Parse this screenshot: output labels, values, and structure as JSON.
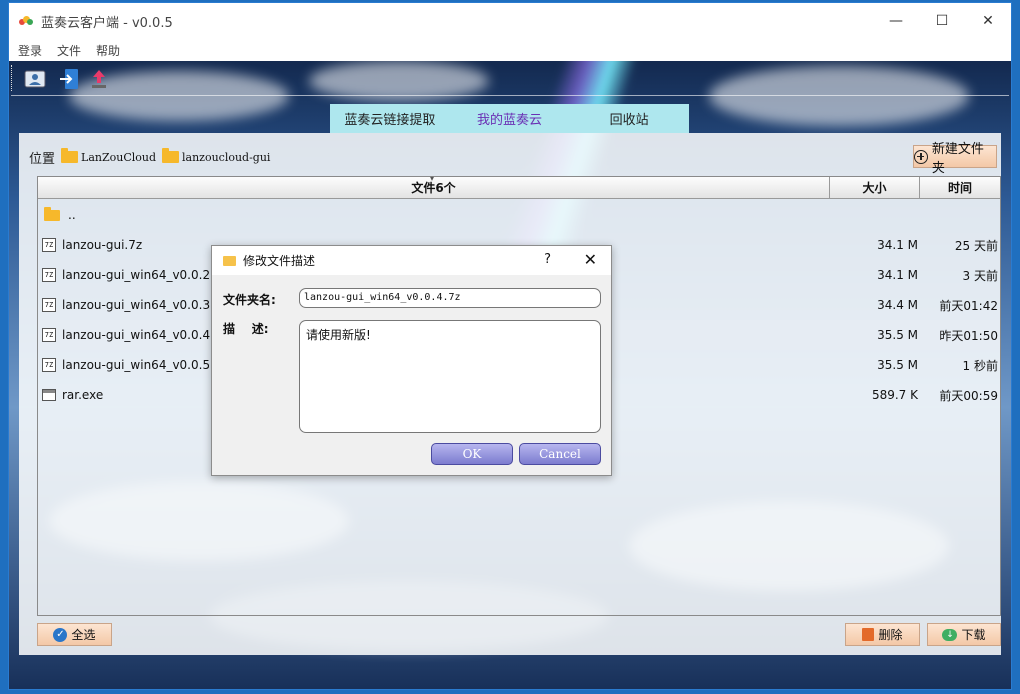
{
  "window": {
    "title": "蓝奏云客户端 - v0.0.5",
    "controls": {
      "minimize": "—",
      "maximize": "☐",
      "close": "✕"
    }
  },
  "menu": [
    "登录",
    "文件",
    "帮助"
  ],
  "toolbar": {
    "icons": [
      "user-card-icon",
      "login-arrow-icon",
      "upload-arrow-icon"
    ]
  },
  "tabs": [
    {
      "label": "蓝奏云链接提取",
      "active": false
    },
    {
      "label": "我的蓝奏云",
      "active": true
    },
    {
      "label": "回收站",
      "active": false
    }
  ],
  "location": {
    "label": "位置",
    "crumbs": [
      "LanZouCloud",
      "lanzoucloud-gui"
    ]
  },
  "new_folder_label": "新建文件夹",
  "table": {
    "columns": {
      "name": "文件6个",
      "size": "大小",
      "time": "时间"
    },
    "rows": [
      {
        "name": "..",
        "size": "",
        "time": "",
        "type": "folder"
      },
      {
        "name": "lanzou-gui.7z",
        "size": "34.1 M",
        "time": "25 天前",
        "type": "7z"
      },
      {
        "name": "lanzou-gui_win64_v0.0.2.7z",
        "size": "34.1 M",
        "time": "3 天前",
        "type": "7z"
      },
      {
        "name": "lanzou-gui_win64_v0.0.3.7z",
        "size": "34.4 M",
        "time": "前天01:42",
        "type": "7z"
      },
      {
        "name": "lanzou-gui_win64_v0.0.4.7z",
        "size": "35.5 M",
        "time": "昨天01:50",
        "type": "7z"
      },
      {
        "name": "lanzou-gui_win64_v0.0.5.7z",
        "size": "35.5 M",
        "time": "1 秒前",
        "type": "7z"
      },
      {
        "name": "rar.exe",
        "size": "589.7 K",
        "time": "前天00:59",
        "type": "exe"
      }
    ]
  },
  "bottom": {
    "select_all": "全选",
    "delete": "删除",
    "download": "下载"
  },
  "dialog": {
    "title": "修改文件描述",
    "help": "?",
    "close": "✕",
    "filename_label": "文件夹名:",
    "filename_value": "lanzou-gui_win64_v0.0.4.7z",
    "desc_label": "描    述:",
    "desc_value": "请使用新版!",
    "ok": "OK",
    "cancel": "Cancel"
  }
}
